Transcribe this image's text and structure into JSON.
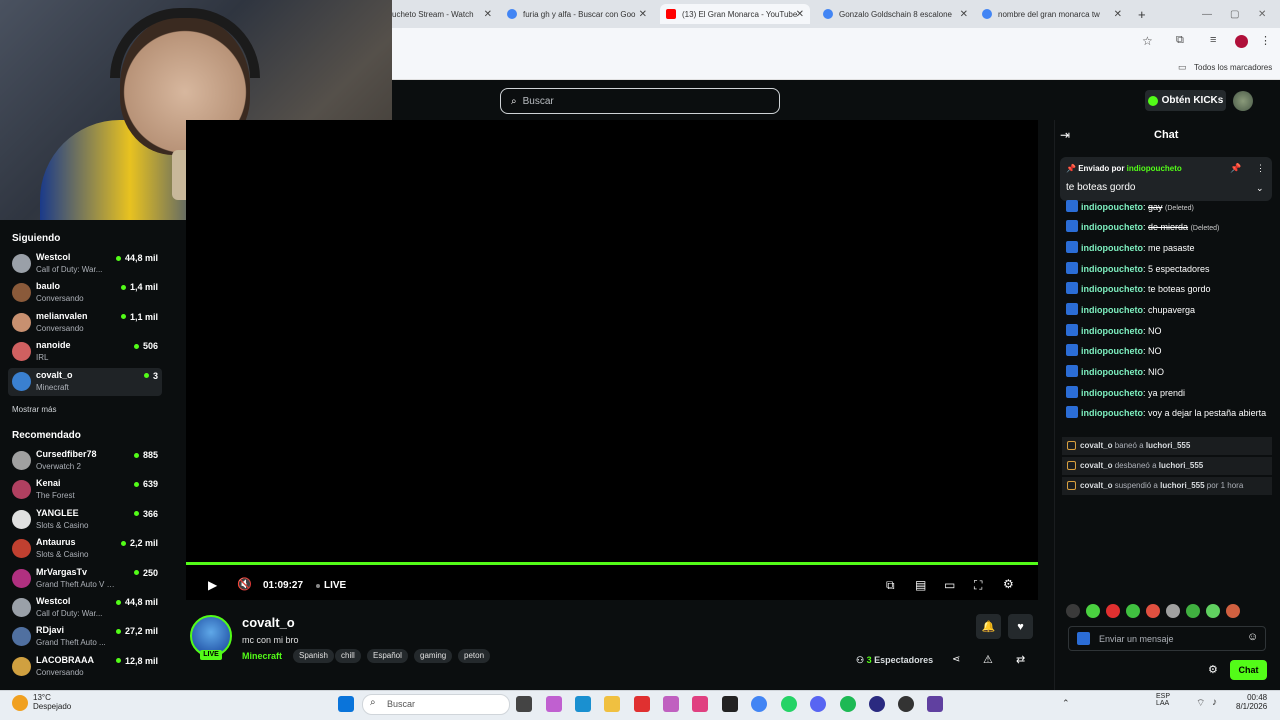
{
  "browser": {
    "tabs": [
      {
        "title": "ucheto Stream - Watch",
        "fav": "#888"
      },
      {
        "title": "furia gh y alfa - Buscar con Goo",
        "fav": "#4285f4"
      },
      {
        "title": "(13) El Gran Monarca - YouTube",
        "fav": "#ff0000",
        "active": true
      },
      {
        "title": "Gonzalo Goldschain 8 escalone",
        "fav": "#4285f4"
      },
      {
        "title": "nombre del gran monarca tw",
        "fav": "#4285f4"
      }
    ],
    "bookmarks_label": "Todos los marcadores"
  },
  "header": {
    "search_placeholder": "Buscar",
    "kicks_label": "Obtén KICKs"
  },
  "sidebar": {
    "following_title": "Siguiendo",
    "following": [
      {
        "name": "Westcol",
        "category": "Call of Duty: War...",
        "viewers": "44,8 mil",
        "color": "#9aa0a8"
      },
      {
        "name": "baulo",
        "category": "Conversando",
        "viewers": "1,4 mil",
        "color": "#8a5a3a"
      },
      {
        "name": "melianvalen",
        "category": "Conversando",
        "viewers": "1,1 mil",
        "color": "#c89070"
      },
      {
        "name": "nanoide",
        "category": "IRL",
        "viewers": "506",
        "color": "#d06060"
      },
      {
        "name": "covalt_o",
        "category": "Minecraft",
        "viewers": "3",
        "color": "#3a80d0",
        "selected": true
      }
    ],
    "show_more": "Mostrar más",
    "recommended_title": "Recomendado",
    "recommended": [
      {
        "name": "Cursedfiber78",
        "category": "Overwatch 2",
        "viewers": "885",
        "color": "#a0a0a0"
      },
      {
        "name": "Kenai",
        "category": "The Forest",
        "viewers": "639",
        "color": "#b04060"
      },
      {
        "name": "YANGLEE",
        "category": "Slots & Casino",
        "viewers": "366",
        "color": "#e0e0e0"
      },
      {
        "name": "Antaurus",
        "category": "Slots & Casino",
        "viewers": "2,2 mil",
        "color": "#c04030"
      },
      {
        "name": "MrVargasTv",
        "category": "Grand Theft Auto V (G...",
        "viewers": "250",
        "color": "#b03080"
      },
      {
        "name": "Westcol",
        "category": "Call of Duty: War...",
        "viewers": "44,8 mil",
        "color": "#9aa0a8"
      },
      {
        "name": "RDjavi",
        "category": "Grand Theft Auto ...",
        "viewers": "27,2 mil",
        "color": "#5070a0"
      },
      {
        "name": "LACOBRAAA",
        "category": "Conversando",
        "viewers": "12,8 mil",
        "color": "#d0a040"
      }
    ]
  },
  "player": {
    "timecode": "01:09:27",
    "live_label": "LIVE"
  },
  "stream": {
    "channel": "covalt_o",
    "title": "mc con mi  bro",
    "category": "Minecraft",
    "live_badge": "LIVE",
    "tags": [
      "Spanish",
      "chill",
      "Español",
      "gaming",
      "peton"
    ],
    "viewer_count": "3",
    "viewer_label": "Espectadores"
  },
  "chat": {
    "title": "Chat",
    "pinned_by_label": "Enviado por",
    "pinned_user": "indiopoucheto",
    "pinned_message": "te boteas gordo",
    "messages": [
      {
        "user": "indiopoucheto",
        "text": "gay",
        "deleted": true
      },
      {
        "user": "indiopoucheto",
        "text": "de mierda",
        "deleted": true
      },
      {
        "user": "indiopoucheto",
        "text": "me pasaste"
      },
      {
        "user": "indiopoucheto",
        "text": "5 espectadores"
      },
      {
        "user": "indiopoucheto",
        "text": "te boteas gordo"
      },
      {
        "user": "indiopoucheto",
        "text": "chupaverga"
      },
      {
        "user": "indiopoucheto",
        "text": "NO"
      },
      {
        "user": "indiopoucheto",
        "text": "NO"
      },
      {
        "user": "indiopoucheto",
        "text": "NIO"
      },
      {
        "user": "indiopoucheto",
        "text": "ya prendi"
      },
      {
        "user": "indiopoucheto",
        "text": "voy a dejar la pestaña abierta"
      }
    ],
    "deleted_tag": "(Deleted)",
    "mod_actions": [
      {
        "actor": "covalt_o",
        "action": "baneó a",
        "target": "luchori_555",
        "suffix": ""
      },
      {
        "actor": "covalt_o",
        "action": "desbaneó a",
        "target": "luchori_555",
        "suffix": ""
      },
      {
        "actor": "covalt_o",
        "action": "suspendió a",
        "target": "luchori_555",
        "suffix": "por 1 hora"
      }
    ],
    "input_placeholder": "Enviar un mensaje",
    "send_label": "Chat",
    "emote_colors": [
      "#3a3a3a",
      "#4ad040",
      "#e03030",
      "#40c040",
      "#e05040",
      "#a0a0a0",
      "#40b040",
      "#60d060",
      "#d06040"
    ]
  },
  "taskbar": {
    "weather_temp": "13°C",
    "weather_desc": "Despejado",
    "search_placeholder": "Buscar",
    "lang": "ESP",
    "lang2": "LAA",
    "time": "00:48",
    "date": "8/1/2026"
  }
}
